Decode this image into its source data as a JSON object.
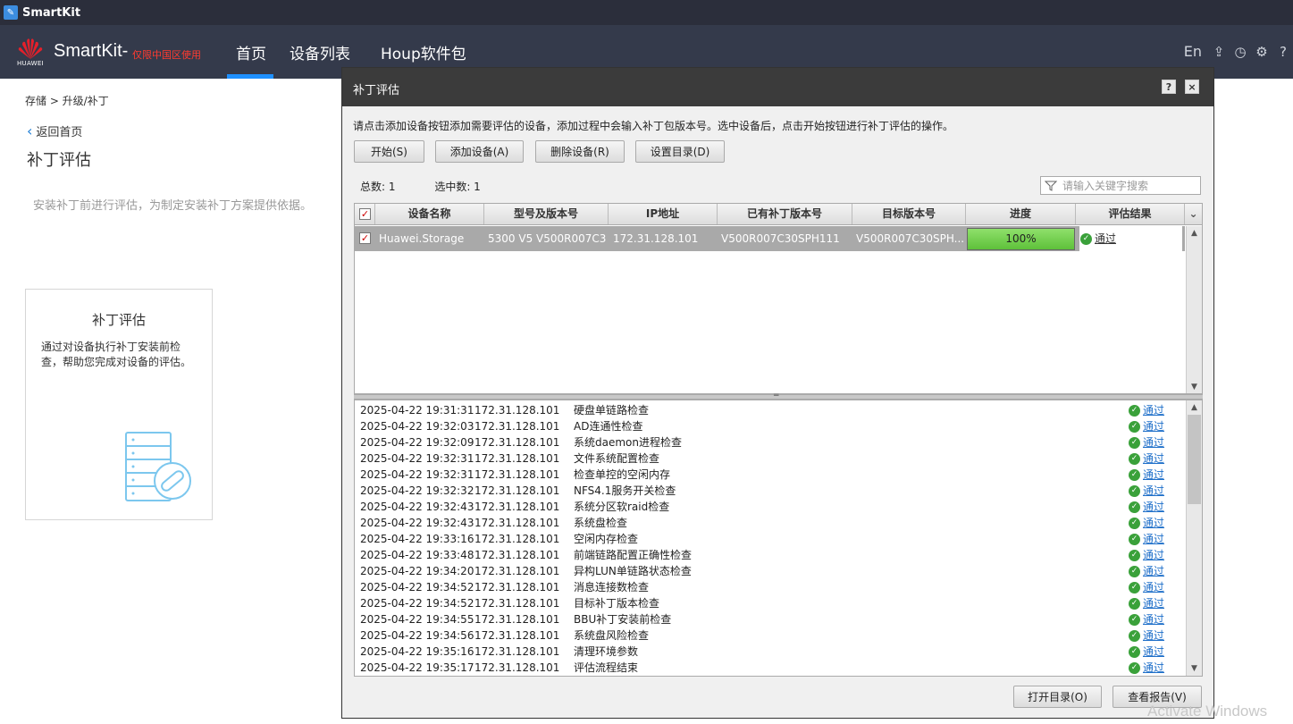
{
  "os": {
    "title": "SmartKit"
  },
  "header": {
    "logo_text": "HUAWEI",
    "brand": "SmartKit-",
    "brand_suffix": "仅限中国区使用",
    "nav": {
      "home": "首页",
      "devices": "设备列表",
      "houp": "Houp软件包"
    },
    "lang": "En"
  },
  "left": {
    "breadcrumb": "存储 > 升级/补丁",
    "back": "返回首页",
    "title": "补丁评估",
    "description": "安装补丁前进行评估，为制定安装补丁方案提供依据。",
    "card": {
      "title": "补丁评估",
      "description": "通过对设备执行补丁安装前检查，帮助您完成对设备的评估。"
    }
  },
  "dialog": {
    "title": "补丁评估",
    "help": "?",
    "close": "×",
    "instruction": "请点击添加设备按钮添加需要评估的设备，添加过程中会输入补丁包版本号。选中设备后，点击开始按钮进行补丁评估的操作。",
    "buttons": {
      "start": "开始(S)",
      "add": "添加设备(A)",
      "delete": "删除设备(R)",
      "set_dir": "设置目录(D)"
    },
    "stats": {
      "total": "总数:  1",
      "selected": "选中数:  1"
    },
    "search_placeholder": "请输入关键字搜索",
    "columns": [
      "设备名称",
      "型号及版本号",
      "IP地址",
      "已有补丁版本号",
      "目标版本号",
      "进度",
      "评估结果"
    ],
    "device": {
      "name": "Huawei.Storage",
      "model": "5300 V5 V500R007C3...",
      "ip": "172.31.128.101",
      "existing_patch": "V500R007C30SPH111",
      "target": "V500R007C30SPH...",
      "progress_label": "100%",
      "progress": 1.0,
      "result": "通过"
    },
    "log": [
      {
        "time": "2025-04-22 19:31:31",
        "ip": "172.31.128.101",
        "check": "硬盘单链路检查",
        "result": "通过"
      },
      {
        "time": "2025-04-22 19:32:03",
        "ip": "172.31.128.101",
        "check": "AD连通性检查",
        "result": "通过"
      },
      {
        "time": "2025-04-22 19:32:09",
        "ip": "172.31.128.101",
        "check": "系统daemon进程检查",
        "result": "通过"
      },
      {
        "time": "2025-04-22 19:32:31",
        "ip": "172.31.128.101",
        "check": "文件系统配置检查",
        "result": "通过"
      },
      {
        "time": "2025-04-22 19:32:31",
        "ip": "172.31.128.101",
        "check": "检查单控的空闲内存",
        "result": "通过"
      },
      {
        "time": "2025-04-22 19:32:32",
        "ip": "172.31.128.101",
        "check": "NFS4.1服务开关检查",
        "result": "通过"
      },
      {
        "time": "2025-04-22 19:32:43",
        "ip": "172.31.128.101",
        "check": "系统分区软raid检查",
        "result": "通过"
      },
      {
        "time": "2025-04-22 19:32:43",
        "ip": "172.31.128.101",
        "check": "系统盘检查",
        "result": "通过"
      },
      {
        "time": "2025-04-22 19:33:16",
        "ip": "172.31.128.101",
        "check": "空闲内存检查",
        "result": "通过"
      },
      {
        "time": "2025-04-22 19:33:48",
        "ip": "172.31.128.101",
        "check": "前端链路配置正确性检查",
        "result": "通过"
      },
      {
        "time": "2025-04-22 19:34:20",
        "ip": "172.31.128.101",
        "check": "异构LUN单链路状态检查",
        "result": "通过"
      },
      {
        "time": "2025-04-22 19:34:52",
        "ip": "172.31.128.101",
        "check": "消息连接数检查",
        "result": "通过"
      },
      {
        "time": "2025-04-22 19:34:52",
        "ip": "172.31.128.101",
        "check": "目标补丁版本检查",
        "result": "通过"
      },
      {
        "time": "2025-04-22 19:34:55",
        "ip": "172.31.128.101",
        "check": "BBU补丁安装前检查",
        "result": "通过"
      },
      {
        "time": "2025-04-22 19:34:56",
        "ip": "172.31.128.101",
        "check": "系统盘风险检查",
        "result": "通过"
      },
      {
        "time": "2025-04-22 19:35:16",
        "ip": "172.31.128.101",
        "check": "清理环境参数",
        "result": "通过"
      },
      {
        "time": "2025-04-22 19:35:17",
        "ip": "172.31.128.101",
        "check": "评估流程结束",
        "result": "通过"
      }
    ],
    "footer": {
      "open_dir": "打开目录(O)",
      "view_report": "查看报告(V)"
    }
  },
  "watermark": "Activate Windows"
}
